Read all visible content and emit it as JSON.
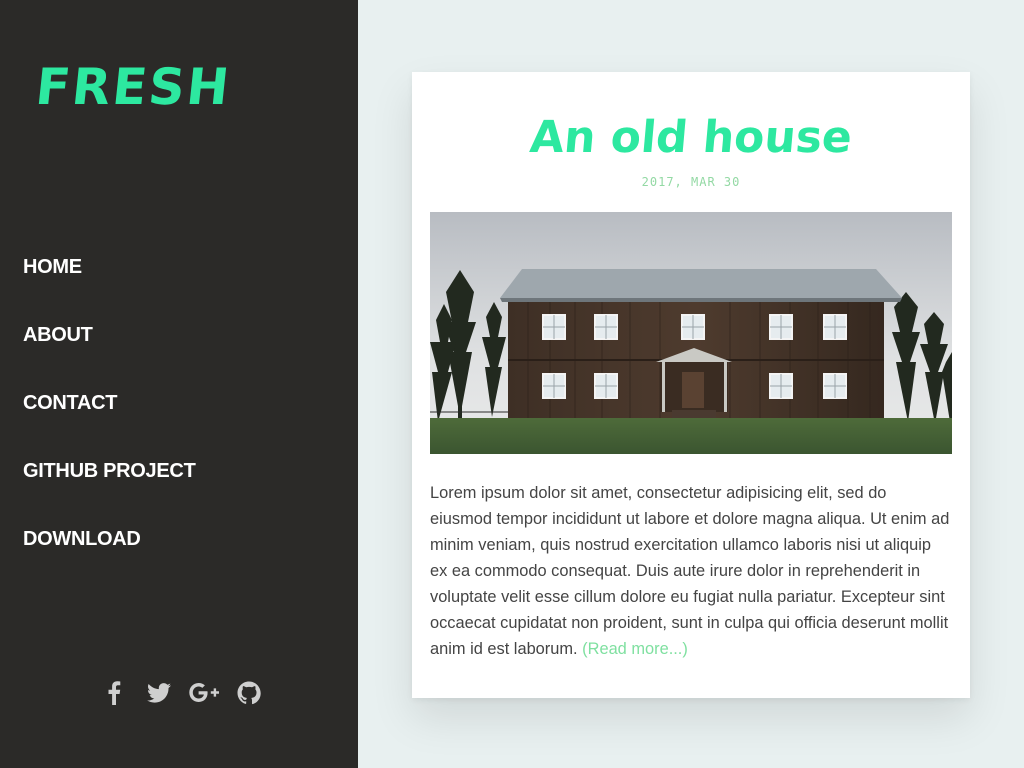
{
  "sidebar": {
    "logo": "FRESH",
    "nav": [
      {
        "label": "HOME"
      },
      {
        "label": "ABOUT"
      },
      {
        "label": "CONTACT"
      },
      {
        "label": "GITHUB PROJECT"
      },
      {
        "label": "DOWNLOAD"
      }
    ],
    "social": [
      {
        "icon": "facebook-icon"
      },
      {
        "icon": "twitter-icon"
      },
      {
        "icon": "google-plus-icon"
      },
      {
        "icon": "github-icon"
      }
    ]
  },
  "post": {
    "title": "An old house",
    "date": "2017, MAR 30",
    "body": "Lorem ipsum dolor sit amet, consectetur adipisicing elit, sed do eiusmod tempor incididunt ut labore et dolore magna aliqua. Ut enim ad minim veniam, quis nostrud exercitation ullamco laboris nisi ut aliquip ex ea commodo consequat. Duis aute irure dolor in reprehenderit in voluptate velit esse cillum dolore eu fugiat nulla pariatur. Excepteur sint occaecat cupidatat non proident, sunt in culpa qui officia deserunt mollit anim id est laborum.",
    "read_more": "(Read more...)"
  },
  "colors": {
    "accent": "#2de8a0",
    "sidebar_bg": "#2b2a28",
    "page_bg": "#e8f0f0",
    "date": "#93d9a4",
    "link": "#7fe0a0"
  }
}
